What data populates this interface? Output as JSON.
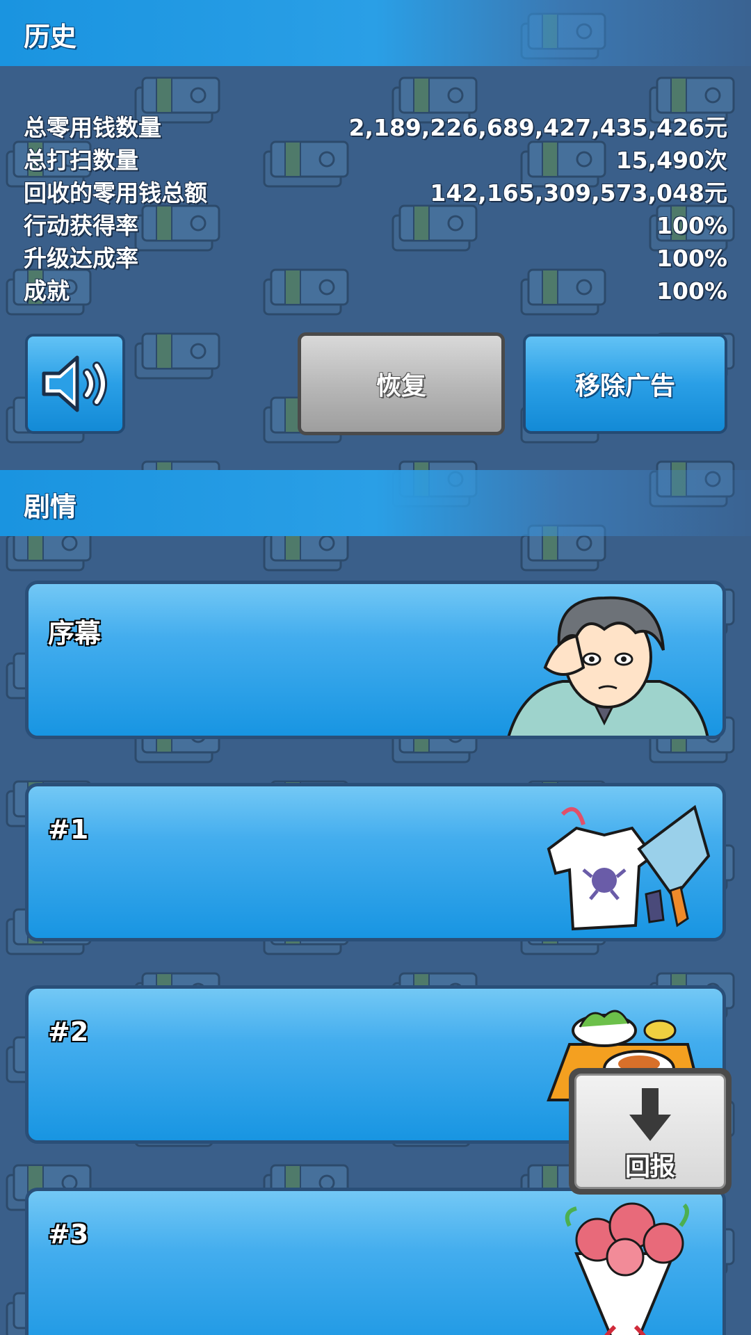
{
  "history": {
    "title": "历史",
    "stats": [
      {
        "label": "总零用钱数量",
        "value": "2,189,226,689,427,435,426元"
      },
      {
        "label": "总打扫数量",
        "value": "15,490次"
      },
      {
        "label": "回收的零用钱总额",
        "value": "142,165,309,573,048元"
      },
      {
        "label": "行动获得率",
        "value": "100%"
      },
      {
        "label": "升级达成率",
        "value": "100%"
      },
      {
        "label": "成就",
        "value": "100%"
      }
    ],
    "sound_icon": "speaker-icon",
    "restore_label": "恢复",
    "remove_ads_label": "移除广告"
  },
  "story": {
    "title": "剧情",
    "chapters": [
      {
        "title": "序幕",
        "icon": "character-portrait-icon"
      },
      {
        "title": "#1",
        "icon": "laundry-icon"
      },
      {
        "title": "#2",
        "icon": "meal-icon"
      },
      {
        "title": "#3",
        "icon": "bouquet-icon"
      }
    ]
  },
  "report_button": {
    "label": "回报",
    "icon": "arrow-down-icon"
  },
  "colors": {
    "header_blue": "#1a94e0",
    "card_blue": "#2a9fe6",
    "background": "#3a5f8a",
    "gray_button": "#b6b6b6"
  }
}
